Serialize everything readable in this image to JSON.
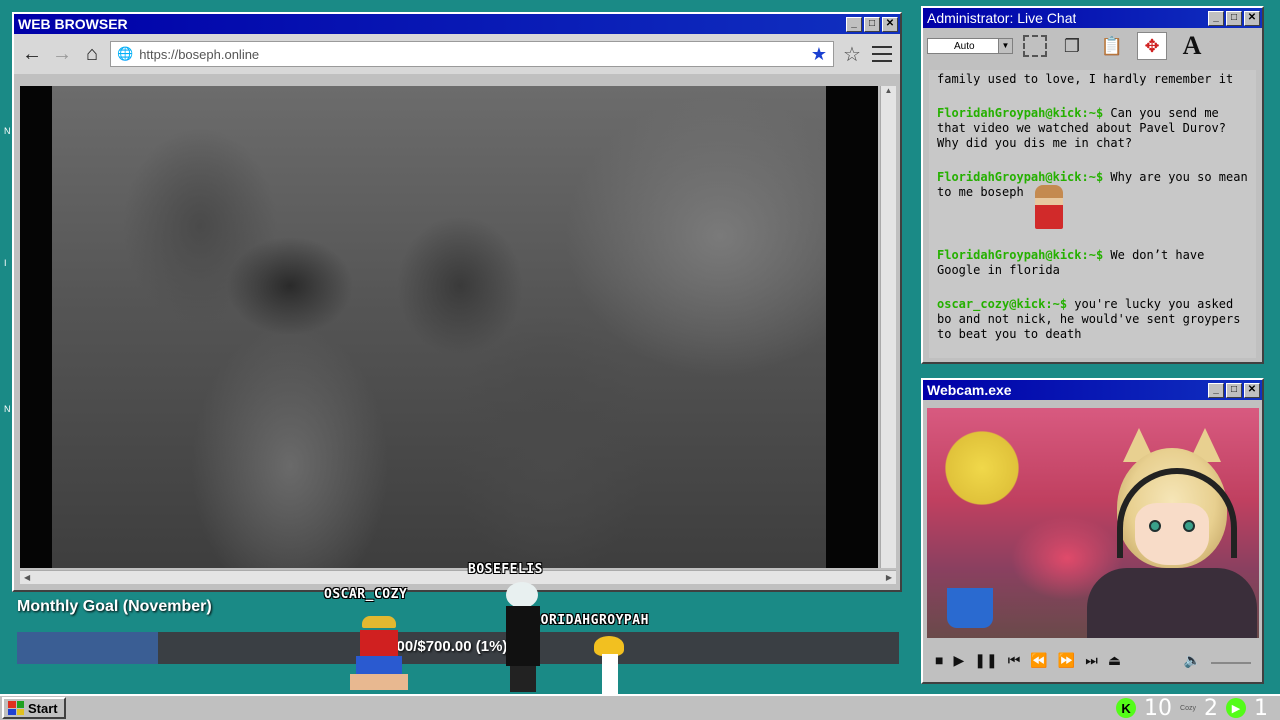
{
  "browser": {
    "title": "WEB BROWSER",
    "url": "https://boseph.online"
  },
  "chat": {
    "title": "Administrator: Live Chat",
    "zoom": "Auto",
    "intro": "family used to love, I hardly remember it",
    "messages": [
      {
        "user": "FloridahGroypah@kick:~$",
        "text": "Can you send me that video we watched about Pavel Durov? Why did you dis me in chat?"
      },
      {
        "user": "FloridahGroypah@kick:~$",
        "text": "Why are you so mean to me boseph"
      },
      {
        "user": "FloridahGroypah@kick:~$",
        "text": "We don’t have Google in florida"
      },
      {
        "user": "oscar_cozy@kick:~$",
        "text": "you're lucky you asked bo and not nick, he would've sent groypers to beat you to death"
      }
    ]
  },
  "webcam": {
    "title": "Webcam.exe"
  },
  "goal": {
    "label": "Monthly Goal (November)",
    "text": "9.00/$700.00 (1%)",
    "progress": 0.16
  },
  "users": {
    "a": "OSCAR_COZY",
    "b": "BOSEFELIS",
    "c": "FLORIDAHGROYPAH"
  },
  "taskbar": {
    "start": "Start",
    "count_a": "10",
    "cozy": "Cozy",
    "count_b": "2",
    "count_c": "1"
  }
}
